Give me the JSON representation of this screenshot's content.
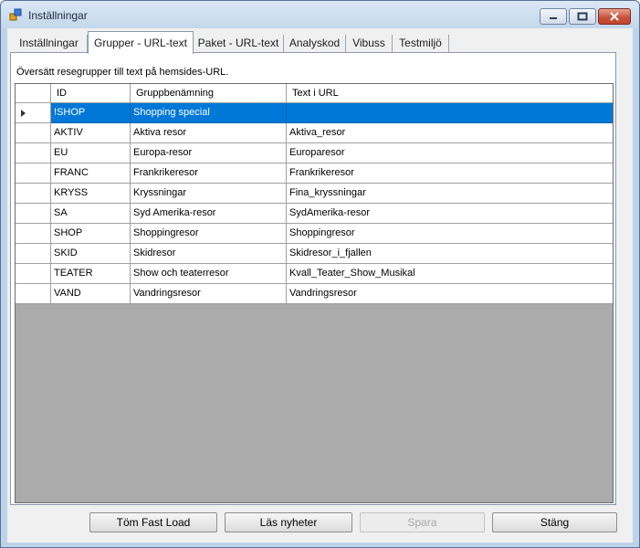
{
  "window": {
    "title": "Inställningar"
  },
  "tabs": [
    {
      "label": "Inställningar"
    },
    {
      "label": "Grupper - URL-text"
    },
    {
      "label": "Paket - URL-text"
    },
    {
      "label": "Analyskod"
    },
    {
      "label": "Vibuss"
    },
    {
      "label": "Testmiljö"
    }
  ],
  "selected_tab": "Grupper - URL-text",
  "description": "Översätt resegrupper till text på hemsides-URL.",
  "grid": {
    "columns": [
      "ID",
      "Gruppbenämning",
      "Text i URL"
    ],
    "rows": [
      [
        "!SHOP",
        "Shopping special",
        ""
      ],
      [
        "AKTIV",
        "Aktiva resor",
        "Aktiva_resor"
      ],
      [
        "EU",
        "Europa-resor",
        "Europaresor"
      ],
      [
        "FRANC",
        "Frankrikeresor",
        "Frankrikeresor"
      ],
      [
        "KRYSS",
        "Kryssningar",
        "Fina_kryssningar"
      ],
      [
        "SA",
        "Syd Amerika-resor",
        "SydAmerika-resor"
      ],
      [
        "SHOP",
        "Shoppingresor",
        "Shoppingresor"
      ],
      [
        "SKID",
        "Skidresor",
        "Skidresor_i_fjallen"
      ],
      [
        "TEATER",
        "Show och teaterresor",
        "Kvall_Teater_Show_Musikal"
      ],
      [
        "VAND",
        "Vandringsresor",
        "Vandringsresor"
      ]
    ],
    "selected_row": "!SHOP",
    "selection_color": "#0078d7"
  },
  "buttons": {
    "clear": "Töm Fast Load",
    "news": "Läs nyheter",
    "save": "Spara",
    "close": "Stäng"
  }
}
